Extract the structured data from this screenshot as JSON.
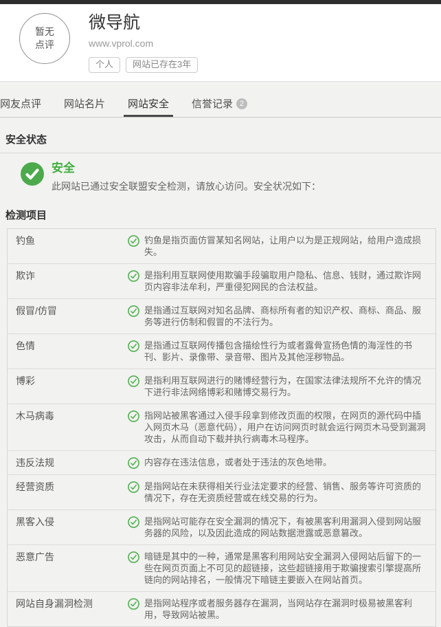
{
  "colors": {
    "topbar": "#2d2d2d",
    "page_background": "#f2f2f0",
    "accent_green_solid": "#4caa4c",
    "accent_green_outline": "#52b052",
    "status_text_green": "#3fae3f",
    "tab_underline": "#4a4a4a",
    "badge_gray": "#bdbdbd"
  },
  "header": {
    "avatar_line1": "暂无",
    "avatar_line2": "点评",
    "title": "微导航",
    "url": "www.vprol.com",
    "tags": [
      "个人",
      "网站已存在3年"
    ]
  },
  "tabs": [
    {
      "label": "网友点评",
      "active": false,
      "badge": null
    },
    {
      "label": "网站名片",
      "active": false,
      "badge": null
    },
    {
      "label": "网站安全",
      "active": true,
      "badge": null
    },
    {
      "label": "信誉记录",
      "active": false,
      "badge": "2"
    }
  ],
  "security_status": {
    "section_title": "安全状态",
    "status_label": "安全",
    "status_desc": "此网站已通过安全联盟安全检测，请放心访问。安全状况如下："
  },
  "detection": {
    "section_title": "检测项目",
    "items": [
      {
        "label": "钓鱼",
        "desc": "钓鱼是指页面仿冒某知名网站，让用户以为是正规网站，给用户造成损失。"
      },
      {
        "label": "欺诈",
        "desc": "是指利用互联网使用欺骗手段骗取用户隐私、信息、钱财，通过欺诈网页内容非法牟利，严重侵犯网民的合法权益。"
      },
      {
        "label": "假冒/仿冒",
        "desc": "是指通过互联网对知名品牌、商标所有者的知识产权、商标、商品、服务等进行仿制和假冒的不法行为。"
      },
      {
        "label": "色情",
        "desc": "是指通过互联网传播包含描绘性行为或者露骨宣扬色情的海淫性的书刊、影片、录像带、录音带、图片及其他淫秽物品。"
      },
      {
        "label": "博彩",
        "desc": "是指利用互联网进行的赌博经营行为，在国家法律法规所不允许的情况下进行非法网络博彩和赌博交易行为。"
      },
      {
        "label": "木马病毒",
        "desc": "指网站被黑客通过入侵手段拿到修改页面的权限，在网页的源代码中插入网页木马（恶意代码），用户在访问网页时就会运行网页木马受到漏洞攻击，从而自动下载并执行病毒木马程序。"
      },
      {
        "label": "违反法规",
        "desc": "内容存在违法信息，或者处于违法的灰色地带。"
      },
      {
        "label": "经营资质",
        "desc": "是指网站在未获得相关行业法定要求的经营、销售、服务等许可资质的情况下，存在无资质经营或在线交易的行为。"
      },
      {
        "label": "黑客入侵",
        "desc": "是指网站可能存在安全漏洞的情况下，有被黑客利用漏洞入侵到网站服务器的风险，以及因此造成的网站数据泄露或恶意篡改。"
      },
      {
        "label": "恶意广告",
        "desc": "暗链是其中的一种，通常是黑客利用网站安全漏洞入侵网站后留下的一些在网页页面上不可见的超链接，这些超链接用于欺骗搜索引擎提高所链向的网站排名，一般情况下暗链主要嵌入在网站首页。"
      },
      {
        "label": "网站自身漏洞检测",
        "desc": "是指网站程序或者服务器存在漏洞，当网站存在漏洞时极易被黑客利用，导致网站被黑。"
      }
    ]
  }
}
